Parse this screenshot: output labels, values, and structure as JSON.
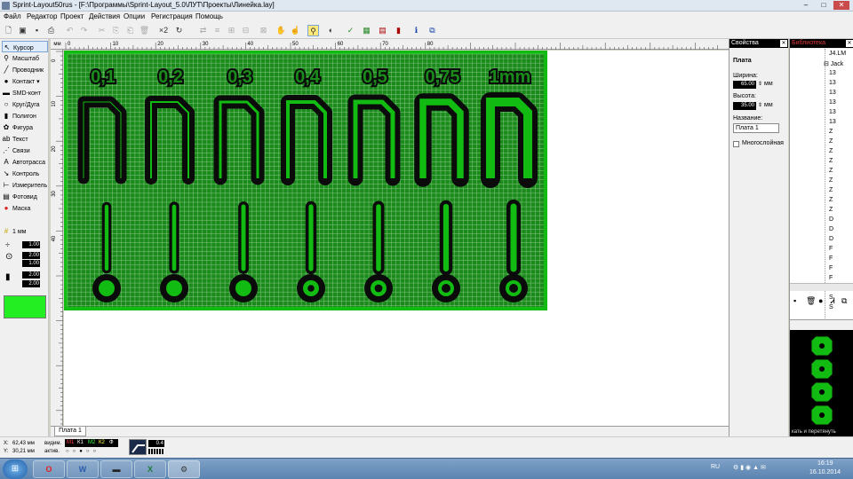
{
  "window": {
    "title": "Sprint-Layout50rus - [F:\\Программы\\Sprint-Layout_5.0\\ЛУТ\\Проекты\\Линейка.lay]",
    "min": "–",
    "max": "□",
    "close": "✕"
  },
  "menu": [
    "Файл",
    "Редактор",
    "Проект",
    "Действия",
    "Опции",
    "Регистрация",
    "Помощь"
  ],
  "toolbar": {
    "zoom_label": "×2",
    "icons": [
      "new-icon",
      "save-icon",
      "print-icon",
      "undo-icon",
      "redo-icon",
      "cut-icon",
      "copy-icon",
      "paste-icon",
      "delete-icon",
      "rotate-icon",
      "mirror-icon",
      "group-icon",
      "ungroup-icon",
      "zoom-icon",
      "drc-icon",
      "info-icon"
    ]
  },
  "tools": {
    "items": [
      {
        "label": "Курсор",
        "icon": "cursor-icon",
        "glyph": "↖",
        "selected": true
      },
      {
        "label": "Масштаб",
        "icon": "zoom-icon",
        "glyph": "⚲"
      },
      {
        "label": "Проводник",
        "icon": "track-icon",
        "glyph": "╱"
      },
      {
        "label": "Контакт",
        "icon": "pad-icon",
        "glyph": "●"
      },
      {
        "label": "SMD-конт",
        "icon": "smd-icon",
        "glyph": "▬"
      },
      {
        "label": "Круг/Дуга",
        "icon": "circle-icon",
        "glyph": "○"
      },
      {
        "label": "Полигон",
        "icon": "polygon-icon",
        "glyph": "▮"
      },
      {
        "label": "Фигура",
        "icon": "shape-icon",
        "glyph": "✿"
      },
      {
        "label": "Текст",
        "icon": "text-icon",
        "glyph": "ab"
      },
      {
        "label": "Связи",
        "icon": "connections-icon",
        "glyph": "⋰"
      },
      {
        "label": "Автотрасса",
        "icon": "autoroute-icon",
        "glyph": "A"
      },
      {
        "label": "Контроль",
        "icon": "test-icon",
        "glyph": "↘"
      },
      {
        "label": "Измеритель",
        "icon": "measure-icon",
        "glyph": "⊢"
      },
      {
        "label": "Фотовид",
        "icon": "photoview-icon",
        "glyph": "▤"
      },
      {
        "label": "Маска",
        "icon": "mask-icon",
        "glyph": "●"
      }
    ],
    "grid": "1 мм",
    "values": [
      "1.00",
      "2.00",
      "1.00",
      "2.00",
      "2.00"
    ],
    "color": "#22ee22"
  },
  "ruler": {
    "unit": "мм",
    "top_ticks": [
      "0",
      "10",
      "20",
      "30",
      "40",
      "50",
      "60",
      "70",
      "80"
    ],
    "left_ticks": [
      "0",
      "10",
      "20",
      "30",
      "40"
    ]
  },
  "board": {
    "labels": [
      "0,1",
      "0,2",
      "0,3",
      "0,4",
      "0,5",
      "0,75",
      "1mm"
    ],
    "copper_color": "#11bb11",
    "board_color": "#1a8a1a",
    "mask_color": "#0b0b0b",
    "grid_color": "#b8e0b8"
  },
  "tabs": {
    "active": "Плата 1"
  },
  "properties": {
    "header": "Свойства",
    "section": "Плата",
    "width_label": "Ширина:",
    "width_value": "65.00",
    "height_label": "Высота:",
    "height_value": "35.00",
    "unit": "мм",
    "name_label": "Название:",
    "name_value": "Плата 1",
    "multilayer": "Многослойная"
  },
  "library": {
    "header": "Библиотека",
    "rows": [
      "J4.LM",
      "Jack",
      "13",
      "13",
      "13",
      "13",
      "13",
      "13",
      "Z",
      "Z",
      "Z",
      "Z",
      "Z",
      "Z",
      "Z",
      "Z",
      "Z",
      "D",
      "D",
      "D",
      "F",
      "F",
      "F",
      "F",
      "S",
      "S",
      "S"
    ],
    "footer": "кать и перетянуть"
  },
  "status": {
    "x_label": "X:",
    "x_value": "62,43 мм",
    "y_label": "Y:",
    "y_value": "30,21 мм",
    "visible": "видим.",
    "active": "актив.",
    "layers": [
      {
        "name": "М1",
        "color": "#ff4040"
      },
      {
        "name": "К1",
        "color": "#ffffff"
      },
      {
        "name": "М2",
        "color": "#40ff40"
      },
      {
        "name": "К2",
        "color": "#ffff40"
      },
      {
        "name": "Ф",
        "color": "#ffffff"
      }
    ],
    "trace_width": "0.4"
  },
  "taskbar": {
    "start": "⊞",
    "apps": [
      {
        "name": "opera-icon",
        "glyph": "O"
      },
      {
        "name": "word-icon",
        "glyph": "W"
      },
      {
        "name": "folder-icon",
        "glyph": "▬"
      },
      {
        "name": "excel-icon",
        "glyph": "X"
      },
      {
        "name": "sprint-layout-icon",
        "glyph": "⚙"
      }
    ],
    "lang": "RU",
    "time": "16:19",
    "date": "16.10.2014"
  }
}
